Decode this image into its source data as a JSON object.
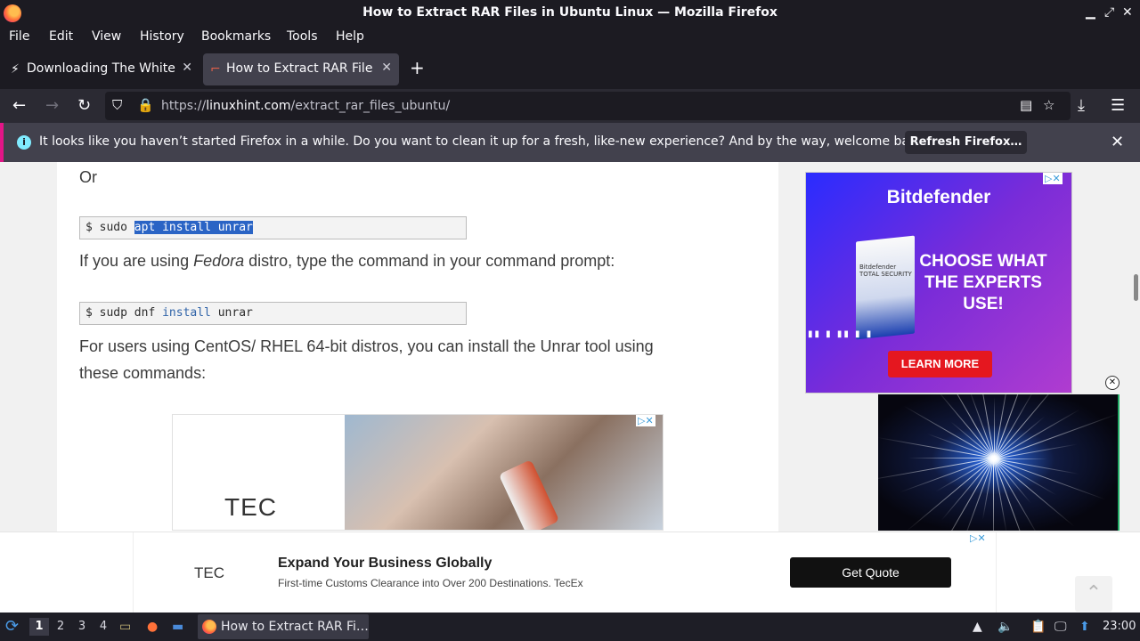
{
  "window": {
    "title": "How to Extract RAR Files in Ubuntu Linux — Mozilla Firefox",
    "controls": [
      "minimize-icon",
      "restore-icon",
      "close-icon"
    ]
  },
  "menu": [
    "File",
    "Edit",
    "View",
    "History",
    "Bookmarks",
    "Tools",
    "Help"
  ],
  "tabs": [
    {
      "label": "Downloading The White",
      "icon": "bolt-icon",
      "active": false
    },
    {
      "label": "How to Extract RAR Files",
      "icon": "site-favicon",
      "active": true
    }
  ],
  "nav": {
    "url_prefix": "https://",
    "url_domain": "linuxhint.com",
    "url_path": "/extract_rar_files_ubuntu/"
  },
  "notification": {
    "message": "It looks like you haven’t started Firefox in a while. Do you want to clean it up for a fresh, like-new experience? And by the way, welcome back!",
    "button": "Refresh Firefox…"
  },
  "article": {
    "or_text": "Or",
    "cmd1_prefix": "$ sudo ",
    "cmd1_selected": "apt install unrar",
    "fedora_pre": "If you are using ",
    "fedora_em": "Fedora",
    "fedora_post": " distro, type the command in your command prompt:",
    "cmd2_prefix": "$ sudp dnf ",
    "cmd2_kw": "install",
    "cmd2_post": " unrar",
    "centos_line1": "For users using CentOS/ RHEL 64-bit distros, you can install the Unrar tool using",
    "centos_line2": "these commands:"
  },
  "inline_ad": {
    "logo": "TEC"
  },
  "side_ad": {
    "brand": "Bitdefender",
    "box_text": "Bitdefender TOTAL SECURITY",
    "headline_1": "CHOOSE WHAT",
    "headline_2": "THE EXPERTS",
    "headline_3": "USE!",
    "cta": "LEARN MORE"
  },
  "bottom_ad": {
    "logo": "TEC",
    "headline": "Expand Your Business Globally",
    "sub": "First-time Customs Clearance into Over 200 Destinations. TecEx",
    "button": "Get Quote"
  },
  "taskbar": {
    "workspaces": [
      "1",
      "2",
      "3",
      "4"
    ],
    "task_label": "How to Extract RAR Fi…",
    "clock": "23:00"
  }
}
